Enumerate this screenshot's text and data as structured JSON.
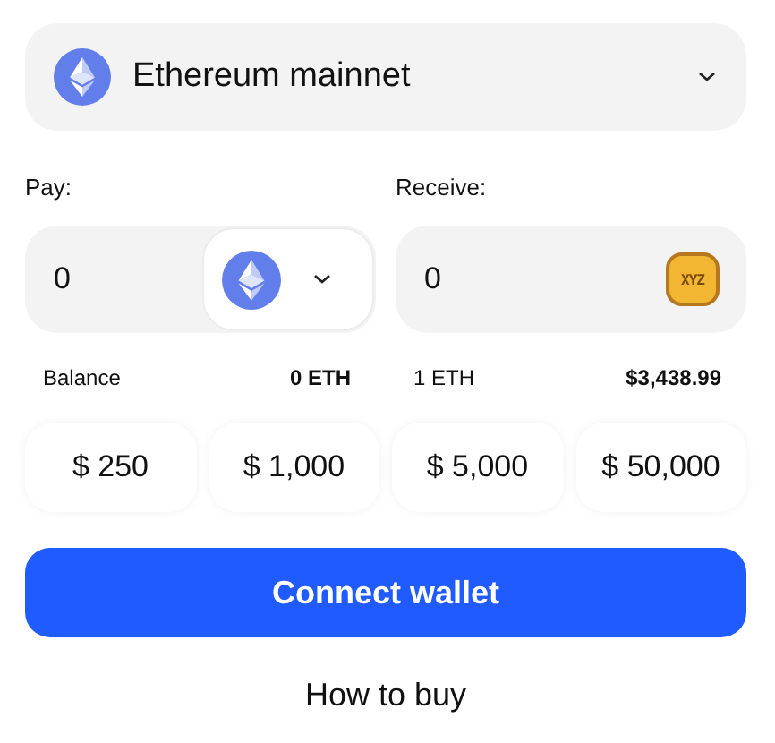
{
  "network": {
    "name": "Ethereum mainnet"
  },
  "pay": {
    "label": "Pay:",
    "value": "0"
  },
  "receive": {
    "label": "Receive:",
    "value": "0",
    "token_symbol": "XYZ"
  },
  "balance": {
    "label": "Balance",
    "value": "0 ETH"
  },
  "rate": {
    "label": "1 ETH",
    "value": "$3,438.99"
  },
  "presets": [
    "$ 250",
    "$ 1,000",
    "$ 5,000",
    "$ 50,000"
  ],
  "connect_button": "Connect wallet",
  "how_to_buy": "How to buy"
}
